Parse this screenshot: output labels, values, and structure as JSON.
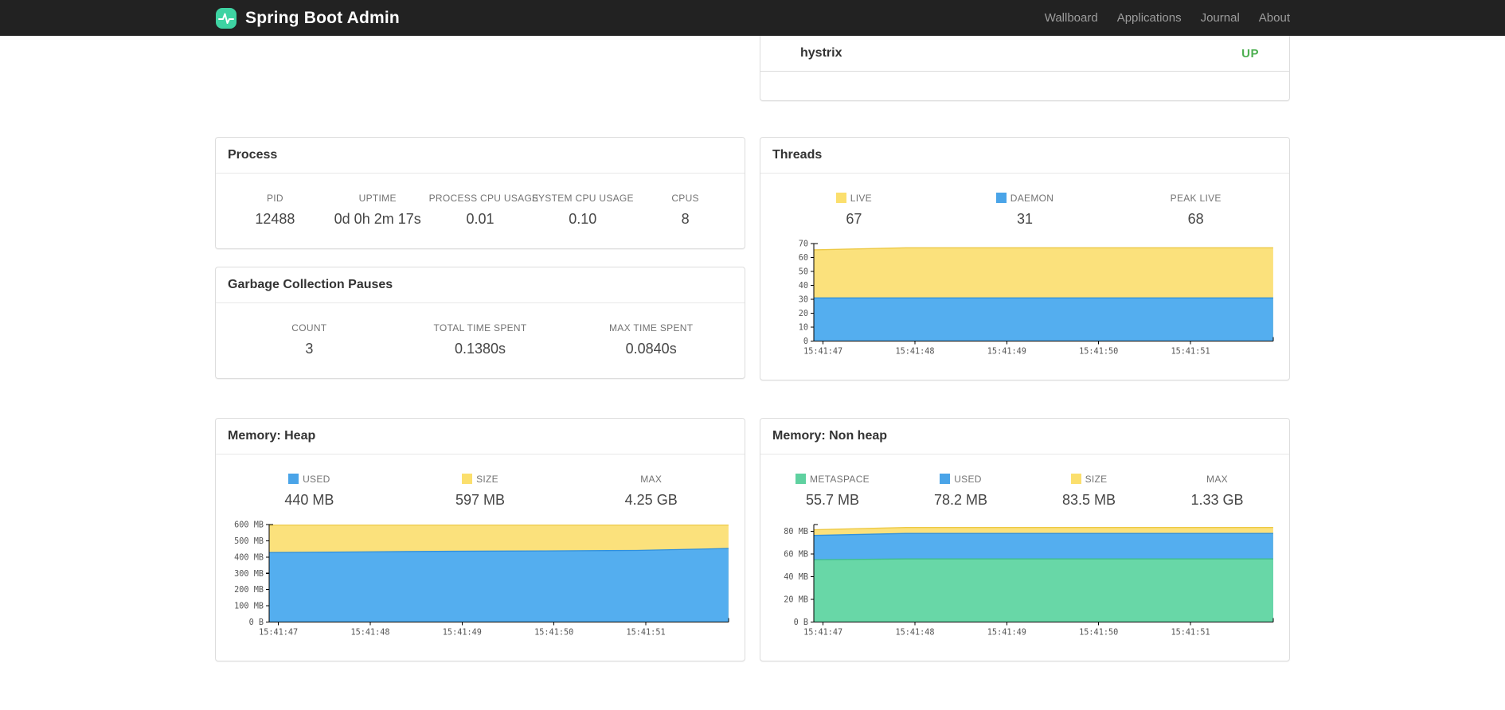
{
  "navbar": {
    "brand": "Spring Boot Admin",
    "links": [
      {
        "label": "Wallboard"
      },
      {
        "label": "Applications"
      },
      {
        "label": "Journal"
      },
      {
        "label": "About"
      }
    ]
  },
  "application": {
    "name": "hystrix",
    "status": "UP",
    "status_color": "#4caf50"
  },
  "process": {
    "title": "Process",
    "stats": [
      {
        "label": "PID",
        "value": "12488"
      },
      {
        "label": "UPTIME",
        "value": "0d 0h 2m 17s"
      },
      {
        "label": "PROCESS CPU USAGE",
        "value": "0.01"
      },
      {
        "label": "SYSTEM CPU USAGE",
        "value": "0.10"
      },
      {
        "label": "CPUS",
        "value": "8"
      }
    ]
  },
  "gc": {
    "title": "Garbage Collection Pauses",
    "stats": [
      {
        "label": "COUNT",
        "value": "3"
      },
      {
        "label": "TOTAL TIME SPENT",
        "value": "0.1380s"
      },
      {
        "label": "MAX TIME SPENT",
        "value": "0.0840s"
      }
    ]
  },
  "threads": {
    "title": "Threads",
    "stats": [
      {
        "label": "LIVE",
        "value": "67",
        "marker": "#fbdf6d"
      },
      {
        "label": "DAEMON",
        "value": "31",
        "marker": "#4aa4e8"
      },
      {
        "label": "PEAK LIVE",
        "value": "68"
      }
    ],
    "chart": {
      "type": "area",
      "y_max": 70,
      "y_ticks": [
        {
          "v": 0,
          "label": "0"
        },
        {
          "v": 10,
          "label": "10"
        },
        {
          "v": 20,
          "label": "20"
        },
        {
          "v": 30,
          "label": "30"
        },
        {
          "v": 40,
          "label": "40"
        },
        {
          "v": 50,
          "label": "50"
        },
        {
          "v": 60,
          "label": "60"
        },
        {
          "v": 70,
          "label": "70"
        }
      ],
      "x_ticks": [
        "15:41:47",
        "15:41:48",
        "15:41:49",
        "15:41:50",
        "15:41:51"
      ],
      "x_tick_fracs": [
        0.02,
        0.22,
        0.42,
        0.62,
        0.82
      ],
      "layers": [
        {
          "name": "LIVE",
          "color": "#fbe17c",
          "stroke": "#edc945",
          "values": [
            65.5,
            67,
            67,
            67,
            67,
            67
          ]
        },
        {
          "name": "DAEMON",
          "color": "#54aeef",
          "stroke": "#3090dd",
          "values": [
            31,
            31,
            31,
            31,
            31,
            31
          ]
        }
      ]
    }
  },
  "heap": {
    "title": "Memory: Heap",
    "stats": [
      {
        "label": "USED",
        "value": "440 MB",
        "marker": "#4aa4e8"
      },
      {
        "label": "SIZE",
        "value": "597 MB",
        "marker": "#fbdf6d"
      },
      {
        "label": "MAX",
        "value": "4.25 GB"
      }
    ],
    "chart": {
      "type": "area",
      "y_max": 600,
      "y_ticks": [
        {
          "v": 0,
          "label": "0 B"
        },
        {
          "v": 100,
          "label": "100 MB"
        },
        {
          "v": 200,
          "label": "200 MB"
        },
        {
          "v": 300,
          "label": "300 MB"
        },
        {
          "v": 400,
          "label": "400 MB"
        },
        {
          "v": 500,
          "label": "500 MB"
        },
        {
          "v": 600,
          "label": "600 MB"
        }
      ],
      "x_ticks": [
        "15:41:47",
        "15:41:48",
        "15:41:49",
        "15:41:50",
        "15:41:51"
      ],
      "x_tick_fracs": [
        0.02,
        0.22,
        0.42,
        0.62,
        0.82
      ],
      "layers": [
        {
          "name": "SIZE",
          "color": "#fbe17c",
          "stroke": "#edc945",
          "values": [
            597,
            597,
            597,
            597,
            597,
            597
          ]
        },
        {
          "name": "USED",
          "color": "#54aeef",
          "stroke": "#3090dd",
          "values": [
            428,
            432,
            436,
            438,
            441,
            453
          ]
        }
      ]
    }
  },
  "nonheap": {
    "title": "Memory: Non heap",
    "stats": [
      {
        "label": "METASPACE",
        "value": "55.7 MB",
        "marker": "#5fd1a0"
      },
      {
        "label": "USED",
        "value": "78.2 MB",
        "marker": "#4aa4e8"
      },
      {
        "label": "SIZE",
        "value": "83.5 MB",
        "marker": "#fbdf6d"
      },
      {
        "label": "MAX",
        "value": "1.33 GB"
      }
    ],
    "chart": {
      "type": "area",
      "y_max": 86,
      "y_ticks": [
        {
          "v": 0,
          "label": "0 B"
        },
        {
          "v": 20,
          "label": "20 MB"
        },
        {
          "v": 40,
          "label": "40 MB"
        },
        {
          "v": 60,
          "label": "60 MB"
        },
        {
          "v": 80,
          "label": "80 MB"
        }
      ],
      "x_ticks": [
        "15:41:47",
        "15:41:48",
        "15:41:49",
        "15:41:50",
        "15:41:51"
      ],
      "x_tick_fracs": [
        0.02,
        0.22,
        0.42,
        0.62,
        0.82
      ],
      "layers": [
        {
          "name": "SIZE",
          "color": "#fbe17c",
          "stroke": "#edc945",
          "values": [
            81.5,
            83.5,
            83.5,
            83.5,
            83.5,
            83.5
          ]
        },
        {
          "name": "USED",
          "color": "#54aeef",
          "stroke": "#3090dd",
          "values": [
            76.5,
            78.2,
            78.2,
            78.2,
            78.2,
            78.2
          ]
        },
        {
          "name": "METASPACE",
          "color": "#68d7a7",
          "stroke": "#3fbd8b",
          "values": [
            55,
            55.7,
            55.7,
            55.7,
            55.7,
            55.7
          ]
        }
      ]
    }
  }
}
